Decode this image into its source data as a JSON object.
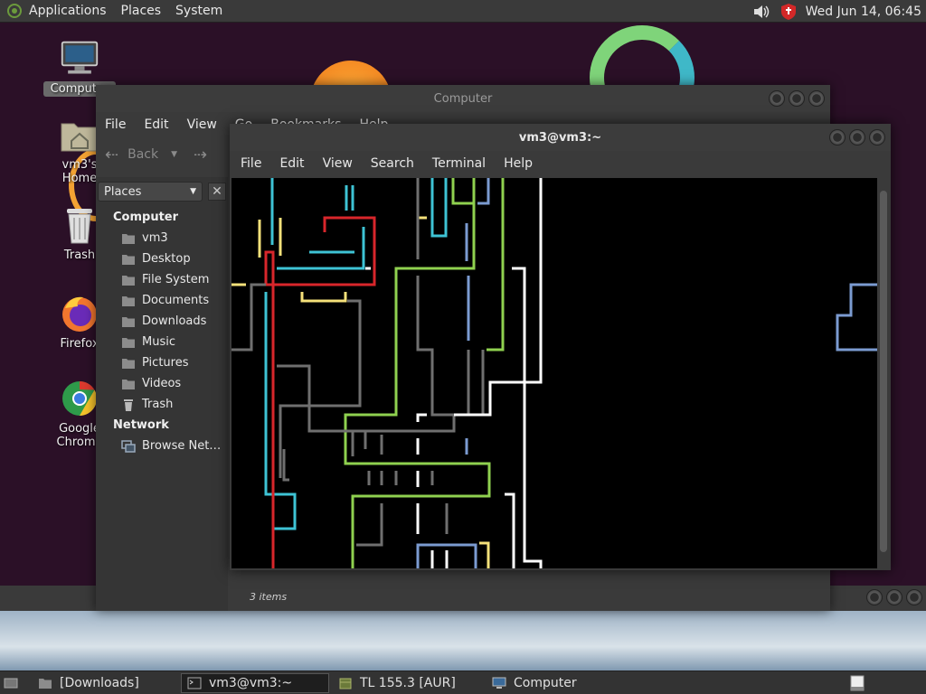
{
  "top_panel": {
    "menus": [
      "Applications",
      "Places",
      "System"
    ],
    "clock": "Wed Jun 14, 06:45",
    "tray_icons": [
      "volume-icon",
      "security-shield-icon"
    ]
  },
  "desktop_icons": [
    {
      "label": "Computer",
      "icon": "computer-icon",
      "selected": true
    },
    {
      "label": "vm3's Home",
      "icon": "home-folder-icon"
    },
    {
      "label": "Trash",
      "icon": "trash-icon"
    },
    {
      "label": "Firefox",
      "icon": "firefox-icon"
    },
    {
      "label": "Google Chrome",
      "icon": "chrome-icon"
    }
  ],
  "file_manager": {
    "title": "Computer",
    "menu": [
      "File",
      "Edit",
      "View",
      "Go",
      "Bookmarks",
      "Help"
    ],
    "toolbar": {
      "back_label": "Back"
    },
    "places_label": "Places",
    "sections": [
      {
        "title": "Computer",
        "items": [
          "vm3",
          "Desktop",
          "File System",
          "Documents",
          "Downloads",
          "Music",
          "Pictures",
          "Videos",
          "Trash"
        ]
      },
      {
        "title": "Network",
        "items": [
          "Browse Net…"
        ]
      }
    ],
    "status": "3 items"
  },
  "terminal": {
    "title": "vm3@vm3:~",
    "menu": [
      "File",
      "Edit",
      "View",
      "Search",
      "Terminal",
      "Help"
    ]
  },
  "taskbar": {
    "tasks": [
      {
        "label": "[Downloads]",
        "icon": "folder-icon",
        "active": false
      },
      {
        "label": "vm3@vm3:~",
        "icon": "terminal-icon",
        "active": true
      },
      {
        "label": "TL 155.3 [AUR]",
        "icon": "package-icon",
        "active": false
      },
      {
        "label": "Computer",
        "icon": "computer-icon",
        "active": false
      }
    ]
  },
  "colors": {
    "line_cyan": "#3ec3d5",
    "line_green": "#8fd14f",
    "line_red": "#d8262b",
    "line_yellow": "#f5e17a",
    "line_blue": "#7b9bd1",
    "line_gray": "#6f6f6f",
    "line_white": "#ffffff"
  }
}
